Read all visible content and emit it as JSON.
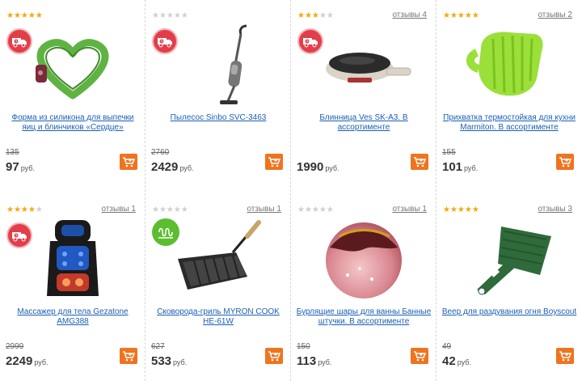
{
  "currency": "руб.",
  "products": [
    {
      "stars": 5,
      "reviews": "",
      "title": "Форма из силикона для выпечки яиц и блинчиков «Сердце»",
      "old_price": "135",
      "price": "97",
      "badge": "delivery"
    },
    {
      "stars": 0,
      "reviews": "",
      "title": "Пылесос Sinbo SVC-3463",
      "old_price": "2760",
      "price": "2429",
      "badge": "delivery"
    },
    {
      "stars": 3,
      "reviews": "отзывы 4",
      "title": "Блинница Ves SK-A3. В ассортименте",
      "old_price": "",
      "price": "1990",
      "badge": "delivery"
    },
    {
      "stars": 5,
      "reviews": "отзывы 2",
      "title": "Прихватка термостойкая для кухни Marmiton. В ассортименте",
      "old_price": "155",
      "price": "101",
      "badge": ""
    },
    {
      "stars": 4,
      "reviews": "отзывы 1",
      "title": "Массажер для тела Gezatone AMG388",
      "old_price": "2999",
      "price": "2249",
      "badge": "delivery"
    },
    {
      "stars": 0,
      "reviews": "отзывы 1",
      "title": "Сковорода-гриль MYRON COOK HE-61W",
      "old_price": "627",
      "price": "533",
      "badge": "induction"
    },
    {
      "stars": 0,
      "reviews": "отзывы 1",
      "title": "Бурлящие шары для ванны Банные штучки. В ассортименте",
      "old_price": "150",
      "price": "113",
      "badge": ""
    },
    {
      "stars": 5,
      "reviews": "отзывы 3",
      "title": "Веер для раздувания огня Boyscout",
      "old_price": "49",
      "price": "42",
      "badge": ""
    }
  ],
  "icons": {
    "delivery_badge": "truck-clock-icon",
    "induction_badge": "induction-icon",
    "cart_button": "cart-icon"
  },
  "colors": {
    "accent_cart": "#f0731e",
    "badge_red": "#e23e4a",
    "badge_green": "#5cbd2f",
    "link": "#1b5fb5",
    "star": "#f5a70a"
  }
}
